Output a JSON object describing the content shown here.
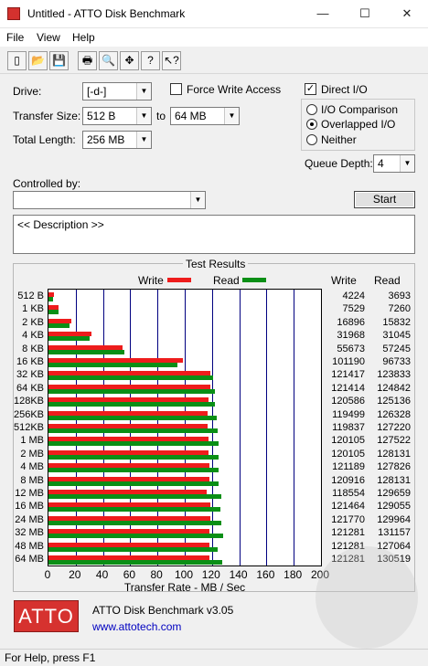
{
  "window": {
    "title": "Untitled - ATTO Disk Benchmark",
    "minimize": "—",
    "maximize": "☐",
    "close": "✕"
  },
  "menu": [
    "File",
    "View",
    "Help"
  ],
  "toolbar": {
    "icons": [
      "new-icon",
      "open-icon",
      "save-icon",
      "print-icon",
      "print-preview-icon",
      "move-icon",
      "help-icon",
      "context-help-icon"
    ],
    "glyphs": [
      "▯",
      "📂",
      "💾",
      "🖶",
      "🔍",
      "✥",
      "?",
      "↖?"
    ]
  },
  "form": {
    "drive_label": "Drive:",
    "drive_value": "[-d-]",
    "transfer_size_label": "Transfer Size:",
    "transfer_from": "512 B",
    "to_label": "to",
    "transfer_to": "64 MB",
    "total_length_label": "Total Length:",
    "total_length_value": "256 MB",
    "force_write_label": "Force Write Access",
    "force_write_checked": false,
    "direct_io_label": "Direct I/O",
    "direct_io_checked": true,
    "io_comparison_label": "I/O Comparison",
    "overlapped_io_label": "Overlapped I/O",
    "neither_label": "Neither",
    "selected_mode": "Overlapped I/O",
    "queue_depth_label": "Queue Depth:",
    "queue_depth_value": "4",
    "controlled_by_label": "Controlled by:",
    "controlled_by_value": "",
    "start_label": "Start",
    "description_text": "<< Description >>"
  },
  "results": {
    "title": "Test Results",
    "legend_write": "Write",
    "legend_read": "Read",
    "col_write": "Write",
    "col_read": "Read"
  },
  "chart_data": {
    "type": "bar",
    "orientation": "horizontal",
    "xlabel": "Transfer Rate - MB / Sec",
    "xlim": [
      0,
      200
    ],
    "xticks": [
      "0",
      "20",
      "40",
      "60",
      "80",
      "100",
      "120",
      "140",
      "160",
      "180",
      "200"
    ],
    "categories": [
      "512 B",
      "1 KB",
      "2 KB",
      "4 KB",
      "8 KB",
      "16 KB",
      "32 KB",
      "64 KB",
      "128KB",
      "256KB",
      "512KB",
      "1 MB",
      "2 MB",
      "4 MB",
      "8 MB",
      "12 MB",
      "16 MB",
      "24 MB",
      "32 MB",
      "48 MB",
      "64 MB"
    ],
    "series": [
      {
        "name": "Write",
        "color": "#ee1c1c",
        "values_kb": [
          4224,
          7529,
          16896,
          31968,
          55673,
          101190,
          121417,
          121414,
          120586,
          119499,
          119837,
          120105,
          120105,
          121189,
          120916,
          118554,
          121464,
          121770,
          121281,
          121281,
          121281
        ]
      },
      {
        "name": "Read",
        "color": "#0a8f16",
        "values_kb": [
          3693,
          7260,
          15832,
          31045,
          57245,
          96733,
          123833,
          124842,
          125136,
          126328,
          127220,
          127522,
          128131,
          127826,
          128131,
          129659,
          129055,
          129964,
          131157,
          127064,
          130519
        ]
      }
    ],
    "grid": true
  },
  "footer": {
    "product": "ATTO Disk Benchmark v3.05",
    "link": "www.attotech.com",
    "logo_text": "ATTO"
  },
  "status": "For Help, press F1"
}
